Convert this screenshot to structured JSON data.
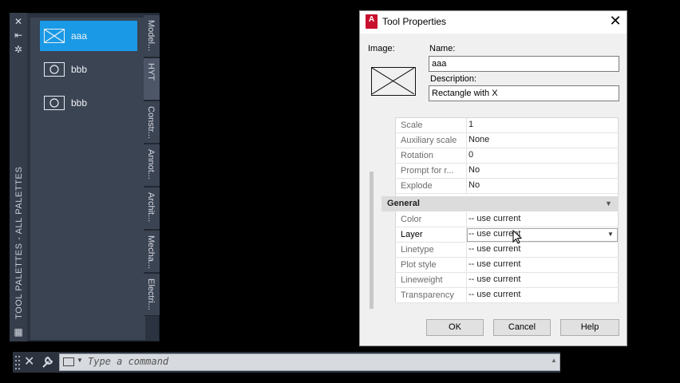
{
  "palette": {
    "title": "TOOL PALETTES - ALL PALETTES",
    "strip_icons": [
      "close-icon",
      "auto-hide-icon",
      "properties-icon"
    ],
    "items": [
      {
        "label": "aaa",
        "icon": "rectangle-x-icon",
        "selected": true
      },
      {
        "label": "bbb",
        "icon": "circle-icon",
        "selected": false
      },
      {
        "label": "bbb",
        "icon": "circle-icon",
        "selected": false
      }
    ],
    "tabs": [
      {
        "label": "Model...",
        "active": false
      },
      {
        "label": "HYT",
        "active": true
      },
      {
        "label": "Constr...",
        "active": false
      },
      {
        "label": "Annot...",
        "active": false
      },
      {
        "label": "Archit...",
        "active": false
      },
      {
        "label": "Mecha...",
        "active": false
      },
      {
        "label": "Electri...",
        "active": false
      }
    ]
  },
  "command_line": {
    "placeholder": "Type a command"
  },
  "dialog": {
    "title": "Tool Properties",
    "image_label": "Image:",
    "name_label": "Name:",
    "name_value": "aaa",
    "description_label": "Description:",
    "description_value": "Rectangle with X",
    "properties": [
      {
        "name": "Scale",
        "value": "1"
      },
      {
        "name": "Auxiliary scale",
        "value": "None"
      },
      {
        "name": "Rotation",
        "value": "0"
      },
      {
        "name": "Prompt for r...",
        "value": "No"
      },
      {
        "name": "Explode",
        "value": "No"
      }
    ],
    "general_label": "General",
    "general": [
      {
        "name": "Color",
        "value": "-- use current"
      },
      {
        "name": "Layer",
        "value": "-- use current"
      },
      {
        "name": "Linetype",
        "value": "-- use current"
      },
      {
        "name": "Plot style",
        "value": "-- use current"
      },
      {
        "name": "Lineweight",
        "value": "-- use current"
      },
      {
        "name": "Transparency",
        "value": "-- use current"
      }
    ],
    "buttons": {
      "ok": "OK",
      "cancel": "Cancel",
      "help": "Help"
    }
  },
  "colors": {
    "accent": "#1a9ae6",
    "palette_bg": "#3b4453",
    "app_icon": "#c8102e"
  }
}
